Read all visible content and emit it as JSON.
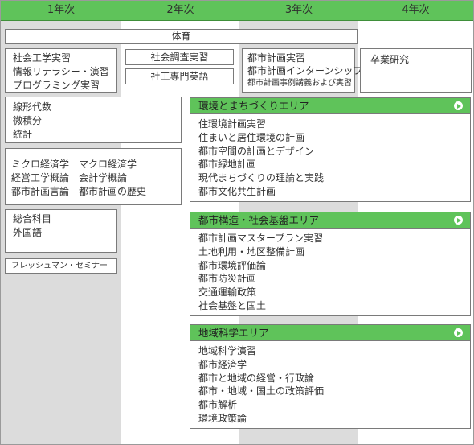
{
  "columns": [
    "1年次",
    "2年次",
    "3年次",
    "4年次"
  ],
  "pe": "体育",
  "year1_box1": [
    "社会工学実習",
    "情報リテラシー・演習",
    "プログラミング実習"
  ],
  "year1_box2": [
    "線形代数",
    "微積分",
    "統計"
  ],
  "year1_box3": [
    "ミクロ経済学　マクロ経済学",
    "経営工学概論　会計学概論",
    "都市計画言論　都市計画の歴史"
  ],
  "year1_box4": [
    "総合科目",
    "外国語"
  ],
  "year1_box5": "フレッシュマン・セミナー",
  "year2_box1": "社会調査実習",
  "year2_box2": "社工専門英語",
  "year3_box1": [
    "都市計画実習",
    "都市計画インターンシップ",
    "都市計画事例講義および実習"
  ],
  "year4_box1": "卒業研究",
  "areas": [
    {
      "title": "環境とまちづくりエリア",
      "icon": "play-circle-icon",
      "items": [
        "住環境計画実習",
        "住まいと居住環境の計画",
        "都市空間の計画とデザイン",
        "都市緑地計画",
        "現代まちづくりの理論と実践",
        "都市文化共生計画"
      ]
    },
    {
      "title": "都市構造・社会基盤エリア",
      "icon": "play-circle-icon",
      "items": [
        "都市計画マスタープラン実習",
        "土地利用・地区整備計画",
        "都市環境評価論",
        "都市防災計画",
        "交通運輸政策",
        "社会基盤と国土"
      ]
    },
    {
      "title": "地域科学エリア",
      "icon": "play-circle-icon",
      "items": [
        "地域科学演習",
        "都市経済学",
        "都市と地域の経営・行政論",
        "都市・地域・国土の政策評価",
        "都市解析",
        "環境政策論"
      ]
    }
  ],
  "colors": {
    "header_green": "#5fc35a",
    "column_grey": "#dcdcdc",
    "border": "#7a7a7a"
  }
}
